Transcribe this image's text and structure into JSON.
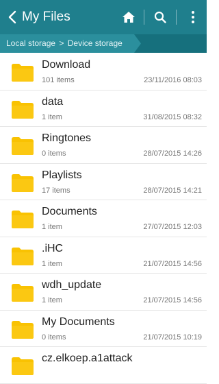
{
  "header": {
    "title": "My Files",
    "back_icon": "chevron-left-icon",
    "actions": [
      "home-icon",
      "search-icon",
      "more-vertical-icon"
    ],
    "color": "#1f7f8d"
  },
  "breadcrumb": {
    "items": [
      "Local storage",
      "Device storage"
    ],
    "separator": ">"
  },
  "folders": [
    {
      "name": "Download",
      "count": "101 items",
      "date": "23/11/2016 08:03"
    },
    {
      "name": "data",
      "count": "1 item",
      "date": "31/08/2015 08:32"
    },
    {
      "name": "Ringtones",
      "count": "0 items",
      "date": "28/07/2015 14:26"
    },
    {
      "name": "Playlists",
      "count": "17 items",
      "date": "28/07/2015 14:21"
    },
    {
      "name": "Documents",
      "count": "1 item",
      "date": "27/07/2015 12:03"
    },
    {
      "name": ".iHC",
      "count": "1 item",
      "date": "21/07/2015 14:56"
    },
    {
      "name": "wdh_update",
      "count": "1 item",
      "date": "21/07/2015 14:56"
    },
    {
      "name": "My Documents",
      "count": "0 items",
      "date": "21/07/2015 10:19"
    },
    {
      "name": "cz.elkoep.a1attack",
      "count": "",
      "date": ""
    }
  ],
  "folder_color": "#f9c202"
}
